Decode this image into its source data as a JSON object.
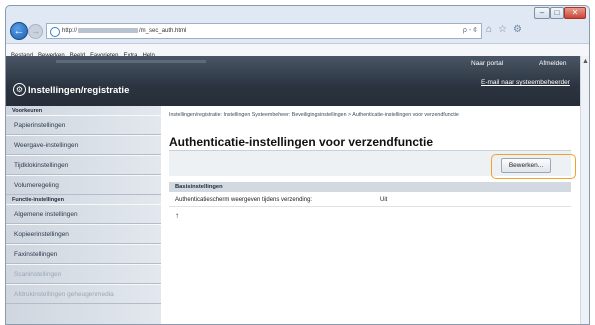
{
  "browser": {
    "url_prefix": "http://",
    "url_suffix": "/m_sec_auth.html",
    "url_controls": "ρ - ¢",
    "menu": [
      "Bestand",
      "Bewerken",
      "Beeld",
      "Favorieten",
      "Extra",
      "Help"
    ],
    "icons": [
      "home-icon",
      "star-icon",
      "gear-icon"
    ]
  },
  "header": {
    "portal_link": "Naar portal",
    "logout_link": "Afmelden",
    "email_link": "E-mail naar systeembeheerder",
    "title": "Instellingen/registratie"
  },
  "sidebar": {
    "section1": "Voorkeuren",
    "items1": [
      "Papierinstellingen",
      "Weergave-instellingen",
      "Tijdklokinstellingen",
      "Volumeregeling"
    ],
    "section2": "Functie-instellingen",
    "items2": [
      "Algemene instellingen",
      "Kopieerinstellingen",
      "Faxinstellingen",
      "Scaninstellingen",
      "Afdrukinstellingen geheugenmedia"
    ]
  },
  "main": {
    "breadcrumb": "Instellingen/registratie: Instellingen Systeembeheer: Beveiligingsinstellingen > Authenticatie-instellingen voor verzendfunctie",
    "title": "Authenticatie-instellingen voor verzendfunctie",
    "edit_button": "Bewerken...",
    "section_title": "Basisinstellingen",
    "row_label": "Authenticatiescherm weergeven tijdens verzending:",
    "row_value": "Uit",
    "top_icon": "↑"
  },
  "colors": {
    "header_bg": "#2b3440",
    "highlight": "#f2a22b",
    "sidebar_bg": "#d9dfe6"
  }
}
